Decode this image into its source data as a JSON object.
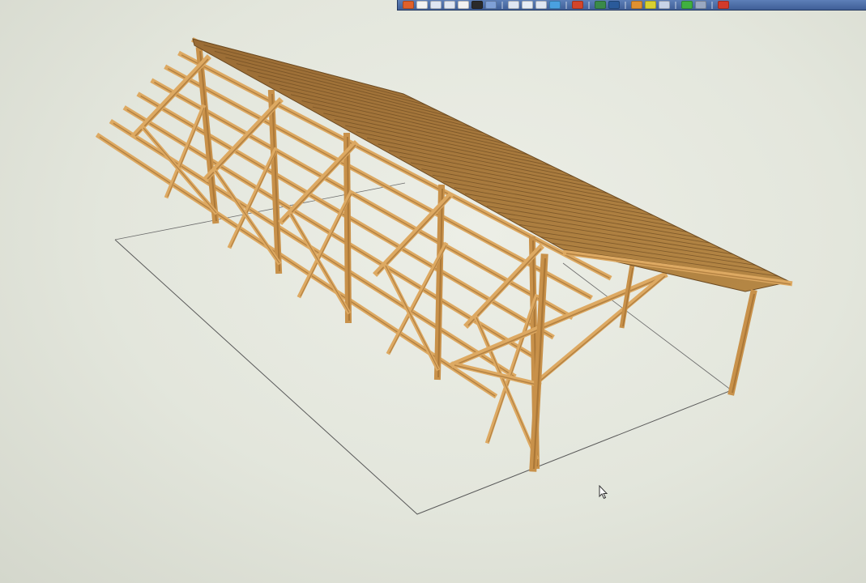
{
  "app": {
    "toolbar": {
      "buttons": [
        {
          "icon": "select-icon",
          "color": "#e0602a"
        },
        {
          "icon": "new-icon",
          "color": "#f2f2f2"
        },
        {
          "icon": "open-icon",
          "color": "#dfe6f2"
        },
        {
          "icon": "save-icon",
          "color": "#dfe6f2"
        },
        {
          "icon": "print-icon",
          "color": "#f2f2f2"
        },
        {
          "icon": "color-swatch-icon",
          "color": "#2a2a2a"
        },
        {
          "icon": "orbit-icon",
          "color": "#7fa0d6"
        },
        {
          "icon": "sep"
        },
        {
          "icon": "copy-icon",
          "color": "#dfe6f2"
        },
        {
          "icon": "paste-icon",
          "color": "#e6ecf5"
        },
        {
          "icon": "undo-icon",
          "color": "#dfe6f2"
        },
        {
          "icon": "redo-icon",
          "color": "#4aa0e0"
        },
        {
          "icon": "sep"
        },
        {
          "icon": "component-icon",
          "color": "#d2452a"
        },
        {
          "icon": "sep"
        },
        {
          "icon": "material-icon",
          "color": "#3a8a4a"
        },
        {
          "icon": "layer-icon",
          "color": "#2a5a9a"
        },
        {
          "icon": "sep"
        },
        {
          "icon": "paint-icon",
          "color": "#e09030"
        },
        {
          "icon": "tape-measure-icon",
          "color": "#d8d030"
        },
        {
          "icon": "pencil-icon",
          "color": "#c8d4e8"
        },
        {
          "icon": "sep"
        },
        {
          "icon": "tree-icon",
          "color": "#40b040"
        },
        {
          "icon": "shadow-icon",
          "color": "#9aa8c0"
        },
        {
          "icon": "sep"
        },
        {
          "icon": "export-icon",
          "color": "#d23a2a"
        }
      ]
    },
    "colors": {
      "timber_light": "#dda962",
      "timber_mid": "#c8914a",
      "timber_dark": "#94642a",
      "roof_board": "#a77a3f",
      "roof_board_dark": "#6d4b22",
      "ground_line": "#5a5a5a"
    }
  }
}
